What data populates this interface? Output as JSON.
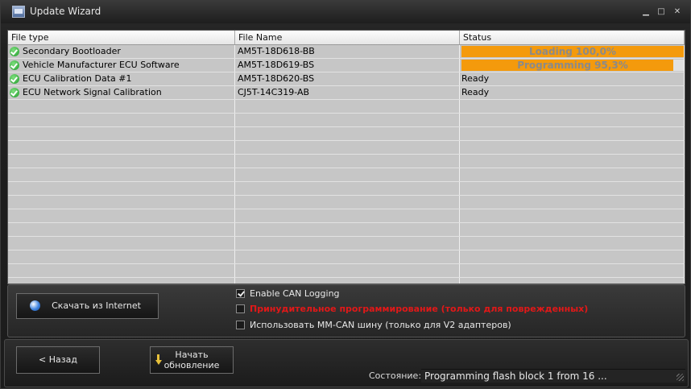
{
  "window": {
    "title": "Update Wizard"
  },
  "grid": {
    "columns": [
      "File type",
      "File Name",
      "Status"
    ],
    "rows": [
      {
        "file_type": "Secondary Bootloader",
        "file_name": "AM5T-18D618-BB",
        "status": "Loading 100,0%",
        "progress": 100.0
      },
      {
        "file_type": "Vehicle Manufacturer ECU Software",
        "file_name": "AM5T-18D619-BS",
        "status": "Programming 95,3%",
        "progress": 95.3
      },
      {
        "file_type": "ECU Calibration Data #1",
        "file_name": "AM5T-18D620-BS",
        "status": "Ready"
      },
      {
        "file_type": "ECU Network Signal Calibration",
        "file_name": "CJ5T-14C319-AB",
        "status": "Ready"
      }
    ]
  },
  "options": {
    "download_label": "Скачать из Internet",
    "enable_can_logging": {
      "label": "Enable CAN Logging",
      "checked": true
    },
    "force_programming": {
      "label": "Принудительное программирование (только для поврежденных)",
      "checked": false
    },
    "use_mm_can": {
      "label": "Использовать MM-CAN шину (только для V2 адаптеров)",
      "checked": false
    }
  },
  "footer": {
    "back_label": "< Назад",
    "start_label_line1": "Начать",
    "start_label_line2": "обновление",
    "status_label": "Состояние:",
    "status_value": "Programming flash block 1 from 16 ..."
  },
  "colors": {
    "progress": "#f49a0c",
    "warning_text": "#e11818"
  }
}
